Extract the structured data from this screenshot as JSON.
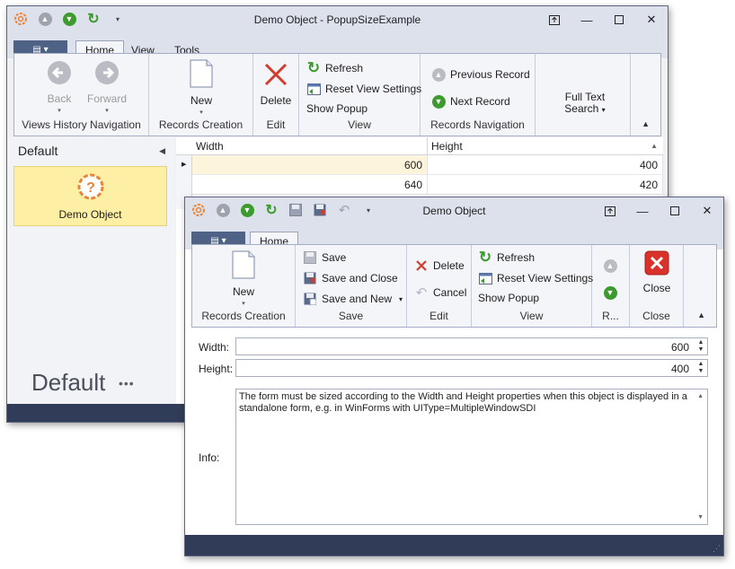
{
  "main_window": {
    "title": "Demo Object - PopupSizeExample",
    "tabs": [
      "Home",
      "View",
      "Tools"
    ],
    "file_button": "▤ ▾",
    "groups": {
      "views_history": {
        "label": "Views History Navigation",
        "back": "Back",
        "forward": "Forward"
      },
      "records_creation": {
        "label": "Records Creation",
        "new": "New"
      },
      "edit": {
        "label": "Edit",
        "delete": "Delete"
      },
      "view": {
        "label": "View",
        "refresh": "Refresh",
        "reset": "Reset View Settings",
        "show_popup": "Show Popup"
      },
      "records_navigation": {
        "label": "Records Navigation",
        "previous": "Previous Record",
        "next": "Next Record"
      },
      "search": {
        "label": "Full Text Search"
      }
    },
    "nav": {
      "header": "Default",
      "item": "Demo Object",
      "footer": "Default",
      "more": "•••"
    },
    "grid": {
      "columns": [
        "Width",
        "Height"
      ],
      "rows": [
        {
          "width": "600",
          "height": "400"
        },
        {
          "width": "640",
          "height": "420"
        }
      ]
    }
  },
  "popup_window": {
    "title": "Demo Object",
    "tabs": [
      "Home"
    ],
    "file_button": "▤ ▾",
    "groups": {
      "records_creation": {
        "label": "Records Creation",
        "new": "New"
      },
      "save": {
        "label": "Save",
        "save": "Save",
        "save_close": "Save and Close",
        "save_new": "Save and New"
      },
      "edit": {
        "label": "Edit",
        "delete": "Delete",
        "cancel": "Cancel"
      },
      "view": {
        "label": "View",
        "refresh": "Refresh",
        "reset": "Reset View Settings",
        "show_popup": "Show Popup"
      },
      "records": {
        "label": "R..."
      },
      "close": {
        "label": "Close",
        "close": "Close"
      }
    },
    "form": {
      "width_label": "Width:",
      "width_value": "600",
      "height_label": "Height:",
      "height_value": "400",
      "info_label": "Info:",
      "info_value": "The form must be sized according to the Width and Height properties when this object is displayed in a standalone form, e.g. in WinForms with UIType=MultipleWindowSDI"
    }
  },
  "colors": {
    "titlebar": "#dde1ec",
    "statusbar": "#313d58",
    "file_button": "#4e6286",
    "selected_nav": "#fdf0a4",
    "selected_row": "#fdf4dc",
    "close_red": "#d9322a",
    "green": "#3c9a2e"
  }
}
